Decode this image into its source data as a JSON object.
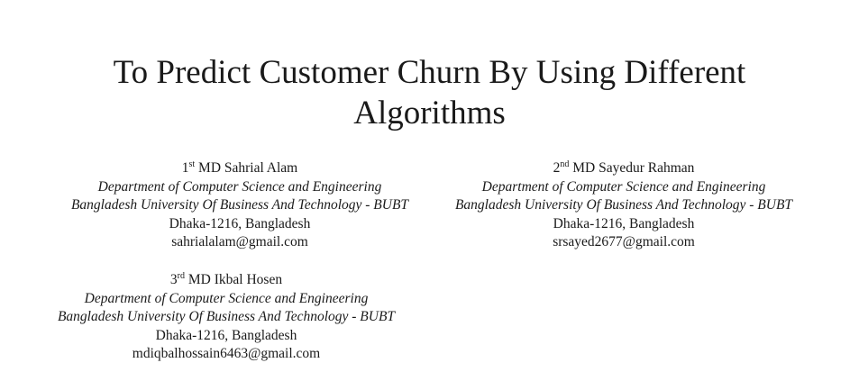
{
  "title_line1": "To Predict Customer Churn By Using Different",
  "title_line2": "Algorithms",
  "authors": [
    {
      "ordinal": "1",
      "suffix": "st",
      "name": "MD Sahrial Alam",
      "department": "Department of Computer Science and Engineering",
      "university": "Bangladesh University Of Business And Technology - BUBT",
      "location": "Dhaka-1216, Bangladesh",
      "email": "sahrialalam@gmail.com"
    },
    {
      "ordinal": "2",
      "suffix": "nd",
      "name": "MD Sayedur Rahman",
      "department": "Department of Computer Science and Engineering",
      "university": "Bangladesh University Of Business And Technology - BUBT",
      "location": "Dhaka-1216, Bangladesh",
      "email": "srsayed2677@gmail.com"
    },
    {
      "ordinal": "3",
      "suffix": "rd",
      "name": "MD Ikbal Hosen",
      "department": "Department of Computer Science and Engineering",
      "university": "Bangladesh University Of Business And Technology - BUBT",
      "location": "Dhaka-1216, Bangladesh",
      "email": "mdiqbalhossain6463@gmail.com"
    }
  ]
}
